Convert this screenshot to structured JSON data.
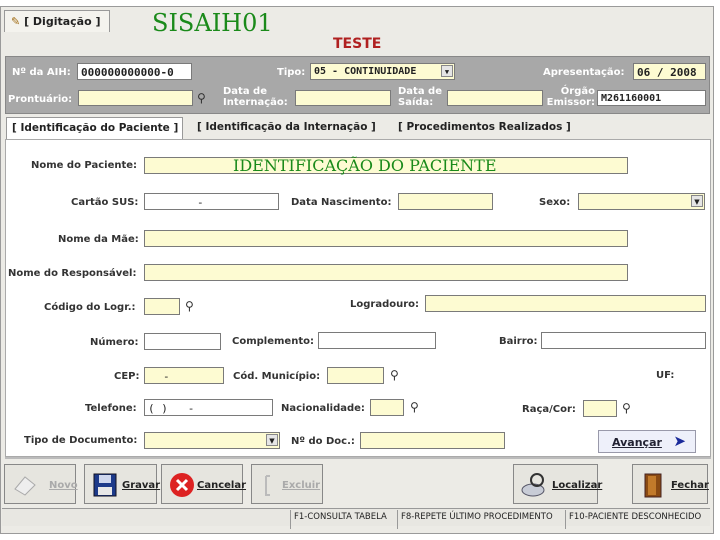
{
  "window": {
    "tab_digitacao": "[ Digitação ]",
    "overlay_title": "SISAIH01",
    "test_title": "TESTE"
  },
  "header": {
    "num_aih_label": "Nº da AIH:",
    "num_aih_value": "000000000000-0",
    "tipo_label": "Tipo:",
    "tipo_value": "05 - CONTINUIDADE",
    "apresentacao_label": "Apresentação:",
    "apresentacao_value": "06 / 2008",
    "prontuario_label": "Prontuário:",
    "data_internacao_label_1": "Data de",
    "data_internacao_label_2": "Internação:",
    "data_saida_label_1": "Data de",
    "data_saida_label_2": "Saída:",
    "orgao_label_1": "Órgão",
    "orgao_label_2": "Emissor:",
    "orgao_value": "M261160001"
  },
  "subtabs": {
    "paciente": "[ Identificação do Paciente ]",
    "internacao": "[ Identificação da Internação ]",
    "procedimentos": "[ Procedimentos Realizados ]"
  },
  "form": {
    "section_overlay": "IDENTIFICAÇÃO DO PACIENTE",
    "nome_paciente": "Nome do Paciente:",
    "cartao_sus": "Cartão SUS:",
    "cartao_sus_value": "-",
    "data_nascimento": "Data Nascimento:",
    "sexo": "Sexo:",
    "nome_mae": "Nome da Mãe:",
    "nome_responsavel": "Nome do Responsável:",
    "codigo_logr": "Código do Logr.:",
    "logradouro": "Logradouro:",
    "numero": "Número:",
    "complemento": "Complemento:",
    "bairro": "Bairro:",
    "cep": "CEP:",
    "cep_value": "-",
    "cod_municipio": "Cód. Município:",
    "uf": "UF:",
    "telefone": "Telefone:",
    "telefone_value": "( )   -",
    "nacionalidade": "Nacionalidade:",
    "raca_cor": "Raça/Cor:",
    "tipo_documento": "Tipo de Documento:",
    "num_doc": "Nº do Doc.:",
    "avancar": "Avançar"
  },
  "toolbar": {
    "novo": "Novo",
    "gravar": "Gravar",
    "cancelar": "Cancelar",
    "excluir": "Excluir",
    "localizar": "Localizar",
    "fechar": "Fechar"
  },
  "status": {
    "f1": "F1-CONSULTA TABELA",
    "f8": "F8-REPETE ÚLTIMO PROCEDIMENTO",
    "f10": "F10-PACIENTE DESCONHECIDO"
  },
  "colors": {
    "field_yellow": "#fdfbd2",
    "header_gray": "#a8a8a8",
    "overlay_green": "#1a8a1a",
    "title_red": "#b02020"
  }
}
